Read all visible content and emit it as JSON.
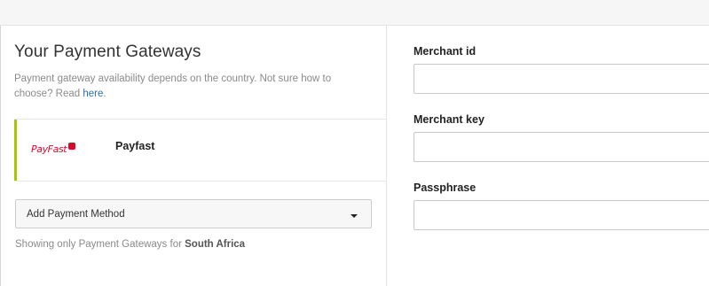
{
  "left": {
    "title": "Your Payment Gateways",
    "description_text": "Payment gateway availability depends on the country. Not sure how to choose? Read ",
    "description_link": "here",
    "description_end": ".",
    "gateway": {
      "logo_text": "PayFast",
      "name": "Payfast",
      "accent_color": "#a7c700",
      "logo_color": "#d0102a"
    },
    "add_method": {
      "label": "Add Payment Method",
      "icon": "caret-down-icon"
    },
    "filter_note": {
      "prefix": "Showing only Payment Gateways for ",
      "country": "South Africa"
    }
  },
  "right": {
    "fields": [
      {
        "label": "Merchant id",
        "value": "",
        "placeholder": ""
      },
      {
        "label": "Merchant key",
        "value": "",
        "placeholder": ""
      },
      {
        "label": "Passphrase",
        "value": "",
        "placeholder": ""
      }
    ]
  },
  "colors": {
    "link": "#2c6db4",
    "topbar": "#f6f6f6"
  }
}
